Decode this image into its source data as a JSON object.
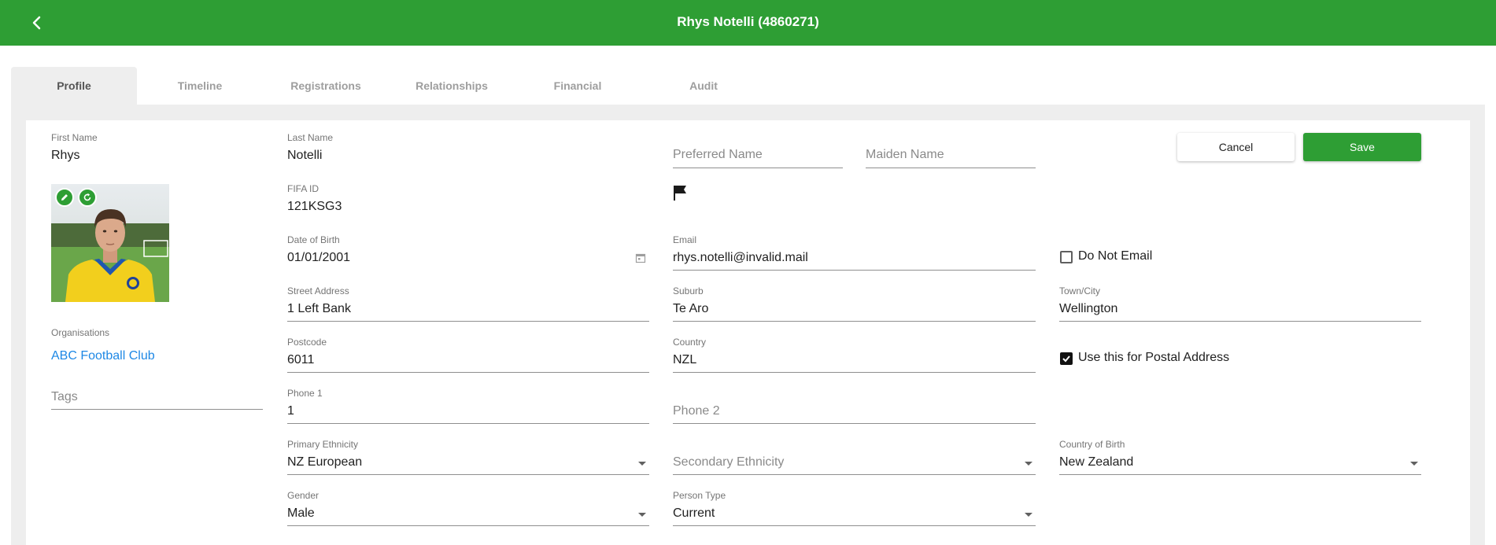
{
  "header": {
    "title": "Rhys Notelli (4860271)",
    "back_icon": "chevron-left-icon",
    "color": "#2e9e34"
  },
  "tabs": [
    {
      "label": "Profile",
      "active": true
    },
    {
      "label": "Timeline",
      "active": false
    },
    {
      "label": "Registrations",
      "active": false
    },
    {
      "label": "Relationships",
      "active": false
    },
    {
      "label": "Financial",
      "active": false
    },
    {
      "label": "Audit",
      "active": false
    }
  ],
  "actions": {
    "cancel_label": "Cancel",
    "save_label": "Save"
  },
  "profile": {
    "first_name": {
      "label": "First Name",
      "value": "Rhys"
    },
    "last_name": {
      "label": "Last Name",
      "value": "Notelli"
    },
    "preferred_name": {
      "placeholder": "Preferred Name"
    },
    "maiden_name": {
      "placeholder": "Maiden Name"
    },
    "fifa_id": {
      "label": "FIFA ID",
      "value": "121KSG3"
    },
    "flag_icon": "flag-icon",
    "photo": {
      "edit_icon": "pencil-icon",
      "refresh_icon": "refresh-icon"
    },
    "organisations": {
      "label": "Organisations",
      "items": [
        "ABC Football Club"
      ]
    },
    "tags": {
      "placeholder": "Tags"
    },
    "date_of_birth": {
      "label": "Date of Birth",
      "value": "01/01/2001",
      "icon": "calendar-icon"
    },
    "email": {
      "label": "Email",
      "value": "rhys.notelli@invalid.mail"
    },
    "do_not_email": {
      "label": "Do Not Email",
      "checked": false
    },
    "street_address": {
      "label": "Street Address",
      "value": "1 Left Bank"
    },
    "suburb": {
      "label": "Suburb",
      "value": "Te Aro"
    },
    "town_city": {
      "label": "Town/City",
      "value": "Wellington"
    },
    "postcode": {
      "label": "Postcode",
      "value": "6011"
    },
    "country": {
      "label": "Country",
      "value": "NZL"
    },
    "use_postal": {
      "label": "Use this for Postal Address",
      "checked": true
    },
    "phone1": {
      "label": "Phone 1",
      "value": "1"
    },
    "phone2": {
      "placeholder": "Phone 2"
    },
    "primary_ethnicity": {
      "label": "Primary Ethnicity",
      "value": "NZ European"
    },
    "secondary_ethnicity": {
      "placeholder": "Secondary Ethnicity"
    },
    "country_of_birth": {
      "label": "Country of Birth",
      "value": "New Zealand"
    },
    "gender": {
      "label": "Gender",
      "value": "Male"
    },
    "person_type": {
      "label": "Person Type",
      "value": "Current"
    }
  }
}
